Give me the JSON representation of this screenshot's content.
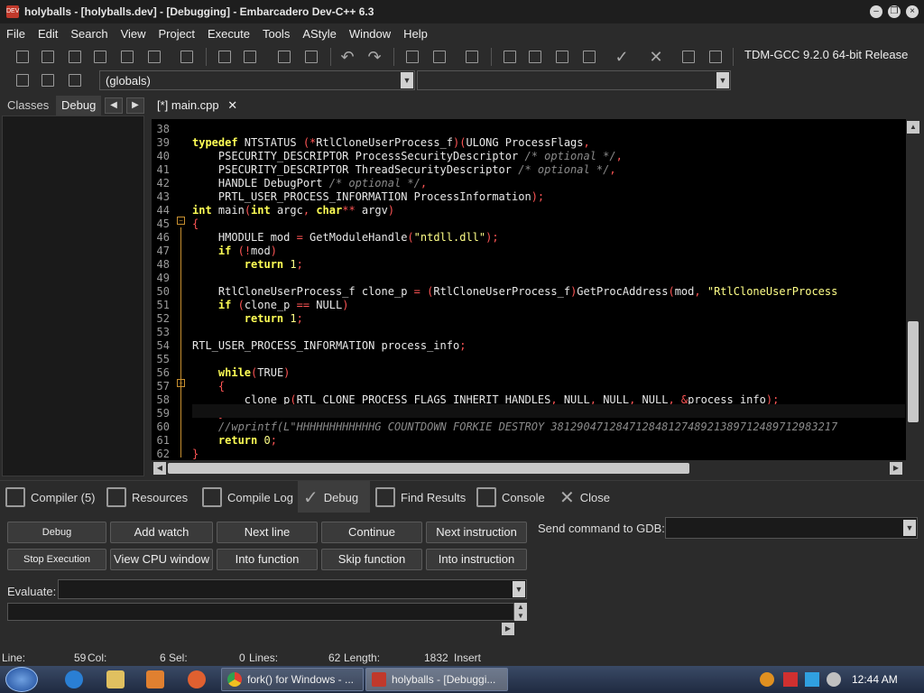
{
  "window": {
    "title": "holyballs - [holyballs.dev] - [Debugging] - Embarcadero Dev-C++ 6.3"
  },
  "menu": [
    "File",
    "Edit",
    "Search",
    "View",
    "Project",
    "Execute",
    "Tools",
    "AStyle",
    "Window",
    "Help"
  ],
  "toolbar": {
    "compiler": "TDM-GCC 9.2.0 64-bit Release",
    "scope": "(globals)"
  },
  "left_tabs": {
    "classes": "Classes",
    "debug": "Debug"
  },
  "editor": {
    "tab": "[*] main.cpp",
    "lines": [
      {
        "n": "38",
        "html": ""
      },
      {
        "n": "39",
        "html": "<span class='kw'>typedef</span> NTSTATUS <span class='sym'>(*</span>RtlCloneUserProcess_f<span class='sym'>)(</span>ULONG ProcessFlags<span class='sym'>,</span>"
      },
      {
        "n": "40",
        "html": "    PSECURITY_DESCRIPTOR ProcessSecurityDescriptor <span class='cm'>/* optional */</span><span class='sym'>,</span>"
      },
      {
        "n": "41",
        "html": "    PSECURITY_DESCRIPTOR ThreadSecurityDescriptor <span class='cm'>/* optional */</span><span class='sym'>,</span>"
      },
      {
        "n": "42",
        "html": "    HANDLE DebugPort <span class='cm'>/* optional */</span><span class='sym'>,</span>"
      },
      {
        "n": "43",
        "html": "    PRTL_USER_PROCESS_INFORMATION ProcessInformation<span class='sym'>);</span>"
      },
      {
        "n": "44",
        "html": "<span class='kw'>int</span> main<span class='sym'>(</span><span class='kw'>int</span> argc<span class='sym'>,</span> <span class='kw'>char</span><span class='sym'>**</span> argv<span class='sym'>)</span>"
      },
      {
        "n": "45",
        "html": "<span class='sym'>{</span>"
      },
      {
        "n": "46",
        "html": "    HMODULE mod <span class='sym'>=</span> GetModuleHandle<span class='sym'>(</span><span class='st'>\"ntdll.dll\"</span><span class='sym'>);</span>"
      },
      {
        "n": "47",
        "html": "    <span class='kw'>if</span> <span class='sym'>(!</span>mod<span class='sym'>)</span>"
      },
      {
        "n": "48",
        "html": "        <span class='kw'>return</span> <span class='st'>1</span><span class='sym'>;</span>"
      },
      {
        "n": "49",
        "html": ""
      },
      {
        "n": "50",
        "html": "    RtlCloneUserProcess_f clone_p <span class='sym'>=</span> <span class='sym'>(</span>RtlCloneUserProcess_f<span class='sym'>)</span>GetProcAddress<span class='sym'>(</span>mod<span class='sym'>,</span> <span class='st'>\"RtlCloneUserProcess</span>"
      },
      {
        "n": "51",
        "html": "    <span class='kw'>if</span> <span class='sym'>(</span>clone_p <span class='sym'>==</span> NULL<span class='sym'>)</span>"
      },
      {
        "n": "52",
        "html": "        <span class='kw'>return</span> <span class='st'>1</span><span class='sym'>;</span>"
      },
      {
        "n": "53",
        "html": ""
      },
      {
        "n": "54",
        "html": "RTL_USER_PROCESS_INFORMATION process_info<span class='sym'>;</span>"
      },
      {
        "n": "55",
        "html": ""
      },
      {
        "n": "56",
        "html": "    <span class='kw'>while</span><span class='sym'>(</span>TRUE<span class='sym'>)</span>"
      },
      {
        "n": "57",
        "html": "    <span class='sym'>{</span>"
      },
      {
        "n": "58",
        "html": "        clone_p<span class='sym'>(</span>RTL_CLONE_PROCESS_FLAGS_INHERIT_HANDLES<span class='sym'>,</span> NULL<span class='sym'>,</span> NULL<span class='sym'>,</span> NULL<span class='sym'>,</span> <span class='sym'>&amp;</span>process_info<span class='sym'>);</span>"
      },
      {
        "n": "59",
        "html": "    <span class='sym'>}</span>"
      },
      {
        "n": "60",
        "html": "    <span class='cm'>//wprintf(L\"HHHHHHHHHHHHG COUNTDOWN FORKIE DESTROY 38129047128471284812748921389712489712983217</span>"
      },
      {
        "n": "61",
        "html": "    <span class='kw'>return</span> <span class='st'>0</span><span class='sym'>;</span>"
      },
      {
        "n": "62",
        "html": "<span class='sym'>}</span>"
      }
    ]
  },
  "bottom_tabs": [
    "Compiler (5)",
    "Resources",
    "Compile Log",
    "Debug",
    "Find Results",
    "Console",
    "Close"
  ],
  "debug_buttons": {
    "row1": [
      "Debug",
      "Add watch",
      "Next line",
      "Continue",
      "Next instruction"
    ],
    "row2": [
      "Stop Execution",
      "View CPU window",
      "Into function",
      "Skip function",
      "Into instruction"
    ]
  },
  "gdb": {
    "label": "Send command to GDB:"
  },
  "evaluate": {
    "label": "Evaluate:"
  },
  "status": {
    "line_label": "Line:",
    "line": "59",
    "col_label": "Col:",
    "col": "6",
    "sel_label": "Sel:",
    "sel": "0",
    "lines_label": "Lines:",
    "lines": "62",
    "length_label": "Length:",
    "length": "1832",
    "mode": "Insert"
  },
  "taskbar": {
    "tasks": [
      "fork() for Windows - ...",
      "holyballs - [Debuggi..."
    ],
    "clock": "12:44 AM"
  }
}
